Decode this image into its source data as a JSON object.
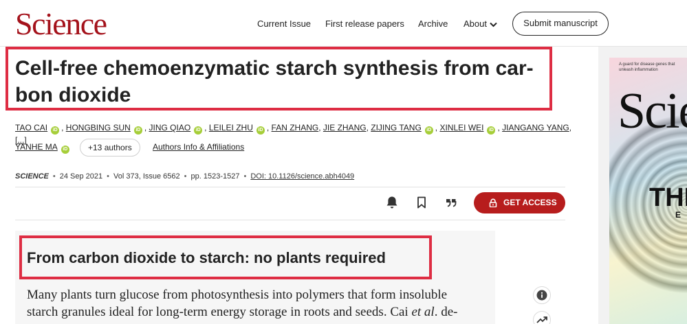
{
  "header": {
    "logo": "Science",
    "nav": [
      "Current Issue",
      "First release papers",
      "Archive",
      "About"
    ],
    "submit": "Submit manuscript"
  },
  "article": {
    "title": "Cell-free chemoenzymatic starch synthesis from car-bon dioxide",
    "title_line1": "Cell-free chemoenzymatic starch synthesis from car-",
    "title_line2": "bon dioxide",
    "authors": [
      "TAO CAI",
      "HONGBING SUN",
      "JING QIAO",
      "LEILEI ZHU",
      "FAN ZHANG",
      "JIE ZHANG",
      "ZIJING TANG",
      "XINLEI WEI",
      "JIANGANG YANG",
      "[...]",
      "YANHE MA"
    ],
    "more_authors": "+13 authors",
    "affiliations_link": "Authors Info & Affiliations",
    "orcid_label": "iD",
    "citation": {
      "journal": "SCIENCE",
      "date": "24 Sep 2021",
      "volume": "Vol 373, Issue 6562",
      "pages": "pp. 1523-1527",
      "doi": "DOI: 10.1126/science.abh4049"
    },
    "get_access": "GET ACCESS"
  },
  "summary": {
    "title": "From carbon dioxide to starch: no plants required",
    "line1": "Many plants turn glucose from photosynthesis into polymers that form insoluble",
    "line2": "starch granules ideal for long-term energy storage in roots and seeds. Cai ",
    "line2_em": "et al",
    "line2_end": ". de-"
  },
  "cover": {
    "small_text": "A guard for disease genes that unleash inflammation",
    "logo": "Science",
    "headline": "THE",
    "sub": "E"
  },
  "colors": {
    "brand": "#a4121b",
    "access_button": "#b71d1d",
    "highlight_box": "#de2d43",
    "orcid": "#a6ce39"
  }
}
